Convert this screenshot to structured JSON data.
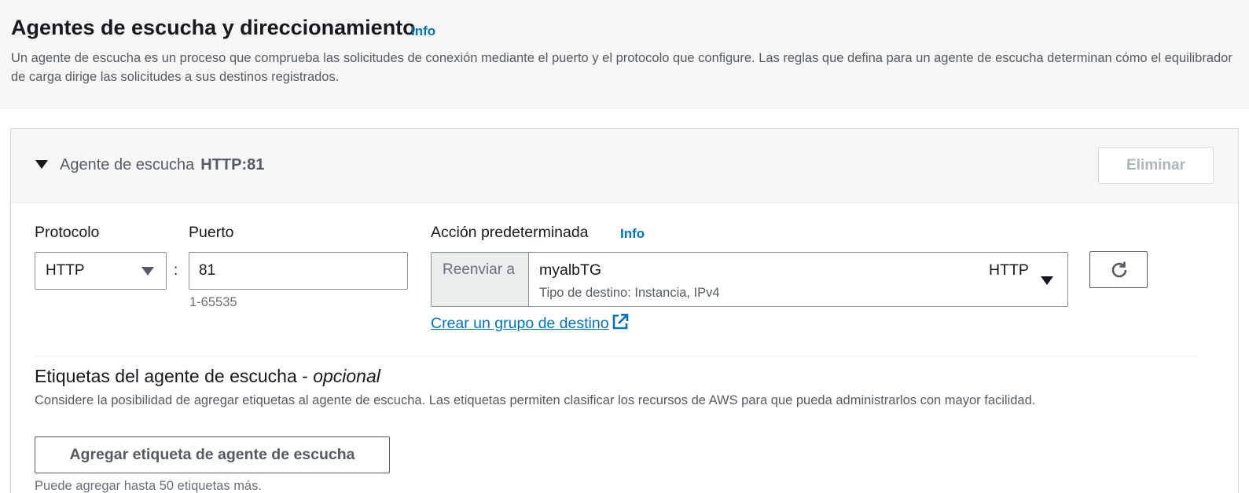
{
  "header": {
    "title": "Agentes de escucha y direccionamiento",
    "info_label": "Info",
    "description": "Un agente de escucha es un proceso que comprueba las solicitudes de conexión mediante el puerto y el protocolo que configure. Las reglas que defina para un agente de escucha determinan cómo el equilibrador de carga dirige las solicitudes a sus destinos registrados."
  },
  "listener": {
    "title": "Agente de escucha",
    "value": "HTTP:81",
    "delete_label": "Eliminar",
    "protocol": {
      "label": "Protocolo",
      "value": "HTTP",
      "icon": "caret-down-icon"
    },
    "port": {
      "label": "Puerto",
      "value": "81",
      "hint": "1-65535"
    },
    "default_action": {
      "label": "Acción predeterminada",
      "info_label": "Info",
      "prefix": "Reenviar a",
      "target_group": "myalbTG",
      "target_protocol": "HTTP",
      "target_type": "Tipo de destino: Instancia, IPv4",
      "create_link": "Crear un grupo de destino",
      "create_link_icon": "external-link-icon",
      "refresh_icon": "refresh-icon"
    }
  },
  "tags": {
    "title": "Etiquetas del agente de escucha - ",
    "title_optional": "opcional",
    "description": "Considere la posibilidad de agregar etiquetas al agente de escucha. Las etiquetas permiten clasificar los recursos de AWS para que pueda administrarlos con mayor facilidad.",
    "add_button": "Agregar etiqueta de agente de escucha",
    "note": "Puede agregar hasta 50 etiquetas más."
  },
  "colors": {
    "link": "#0073bb",
    "text": "#16191f",
    "muted": "#545b64",
    "header_bg": "#f7f7f7"
  }
}
